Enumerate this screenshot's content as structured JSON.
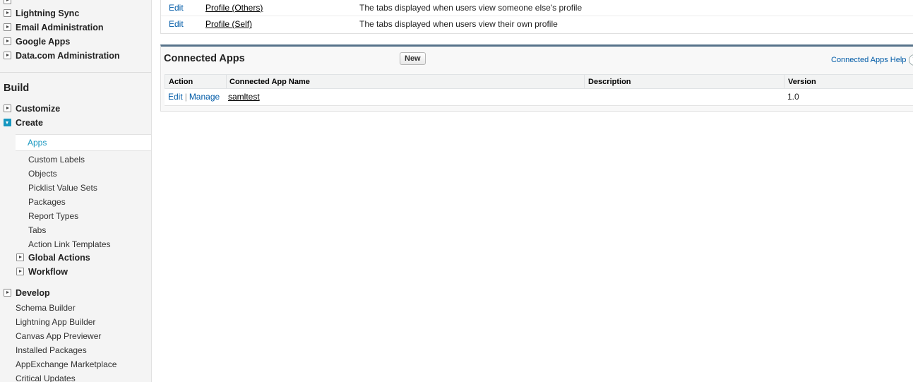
{
  "sidebar": {
    "top_items": [
      {
        "label": "Lightning Sync"
      },
      {
        "label": "Email Administration"
      },
      {
        "label": "Google Apps"
      },
      {
        "label": "Data.com Administration"
      }
    ],
    "build_title": "Build",
    "build_items": {
      "customize": "Customize",
      "create": "Create",
      "apps": "Apps",
      "create_children": [
        "Custom Labels",
        "Objects",
        "Picklist Value Sets",
        "Packages",
        "Report Types",
        "Tabs",
        "Action Link Templates"
      ],
      "global_actions": "Global Actions",
      "workflow": "Workflow"
    },
    "develop": {
      "label": "Develop",
      "children": [
        "Schema Builder",
        "Lightning App Builder",
        "Canvas App Previewer",
        "Installed Packages",
        "AppExchange Marketplace",
        "Critical Updates"
      ]
    }
  },
  "tab_settings_rows": [
    {
      "action": "Edit",
      "name": "Profile (Others)",
      "description": "The tabs displayed when users view someone else's profile"
    },
    {
      "action": "Edit",
      "name": "Profile (Self)",
      "description": "The tabs displayed when users view their own profile"
    }
  ],
  "connected_apps": {
    "title": "Connected Apps",
    "new_button": "New",
    "help_link": "Connected Apps Help",
    "help_icon": "?",
    "columns": {
      "action": "Action",
      "name": "Connected App Name",
      "description": "Description",
      "version": "Version"
    },
    "rows": [
      {
        "edit": "Edit",
        "separator": "|",
        "manage": "Manage",
        "name": "samltest",
        "description": "",
        "version": "1.0"
      }
    ]
  }
}
